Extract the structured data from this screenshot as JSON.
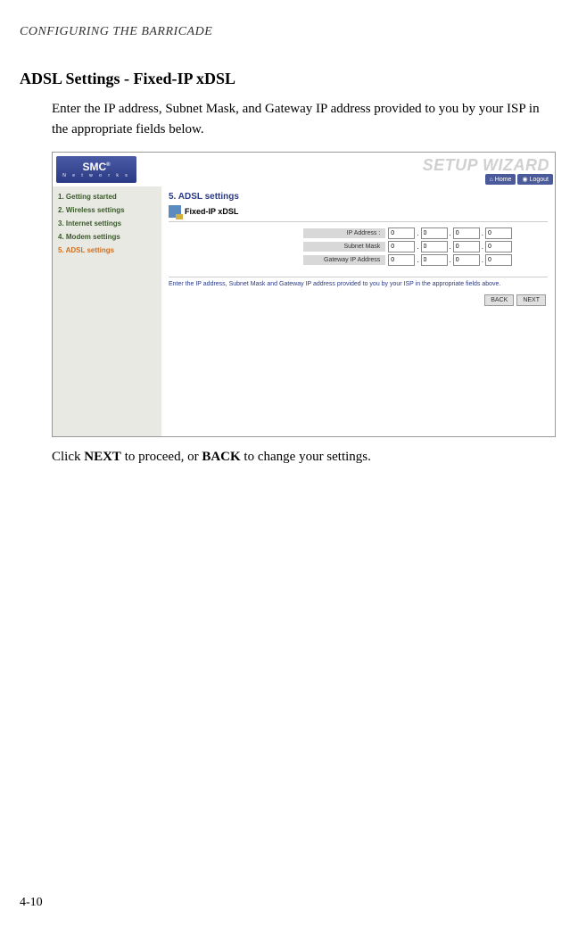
{
  "page": {
    "header": "CONFIGURING THE BARRICADE",
    "section_title": "ADSL Settings - Fixed-IP xDSL",
    "intro": "Enter the IP address, Subnet Mask, and Gateway IP address provided to you by your ISP in the appropriate fields below.",
    "outro_pre": "Click ",
    "outro_next": "NEXT",
    "outro_mid": " to proceed, or ",
    "outro_back": "BACK",
    "outro_post": " to change your settings.",
    "page_num": "4-10"
  },
  "screenshot": {
    "logo": "SMC",
    "logo_reg": "®",
    "logo_sub": "N e t w o r k s",
    "wizard": "SETUP WIZARD",
    "home_btn": "Home",
    "logout_btn": "Logout",
    "sidebar": [
      {
        "label": "1. Getting started",
        "cls": ""
      },
      {
        "label": "2. Wireless settings",
        "cls": ""
      },
      {
        "label": "3. Internet settings",
        "cls": ""
      },
      {
        "label": "4. Modem settings",
        "cls": ""
      },
      {
        "label": "5. ADSL settings",
        "cls": "orange"
      }
    ],
    "main_title": "5. ADSL settings",
    "sub_title": "Fixed-IP xDSL",
    "rows": [
      {
        "label": "IP Address :",
        "v": [
          "0",
          "0",
          "0",
          "0"
        ]
      },
      {
        "label": "Subnet Mask",
        "v": [
          "0",
          "0",
          "0",
          "0"
        ]
      },
      {
        "label": "Gateway IP Address",
        "v": [
          "0",
          "0",
          "0",
          "0"
        ]
      }
    ],
    "note": "Enter the IP address, Subnet Mask and Gateway IP address provided to you by your ISP in the appropriate fields above.",
    "back": "BACK",
    "next": "NEXT"
  }
}
